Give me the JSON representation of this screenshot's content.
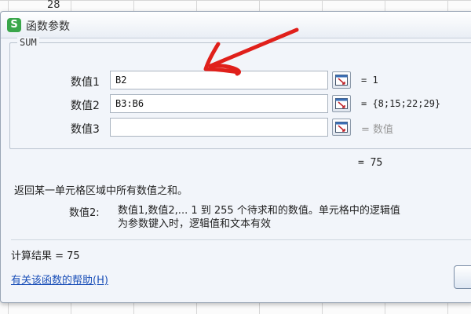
{
  "background": {
    "cell_value": "28"
  },
  "dialog": {
    "title": "函数参数",
    "app_icon_glyph": "S",
    "function_name": "SUM",
    "args": [
      {
        "label": "数值1",
        "value": "B2",
        "result": "= 1",
        "result_muted": false
      },
      {
        "label": "数值2",
        "value": "B3:B6",
        "result": "= {8;15;22;29}",
        "result_muted": false
      },
      {
        "label": "数值3",
        "value": "",
        "result": "= 数值",
        "result_muted": true
      }
    ],
    "function_result": "= 75",
    "description": "返回某一单元格区域中所有数值之和。",
    "param_label": "数值2:",
    "param_description": "数值1,数值2,... 1 到 255 个待求和的数值。单元格中的逻辑值\n为参数键入时，逻辑值和文本有效",
    "calc_result": "计算结果 = 75",
    "help_link": "有关该函数的帮助(H)"
  },
  "colors": {
    "annotation": "#e0201b",
    "brand": "#3aa64b",
    "link": "#1a4fb8"
  }
}
